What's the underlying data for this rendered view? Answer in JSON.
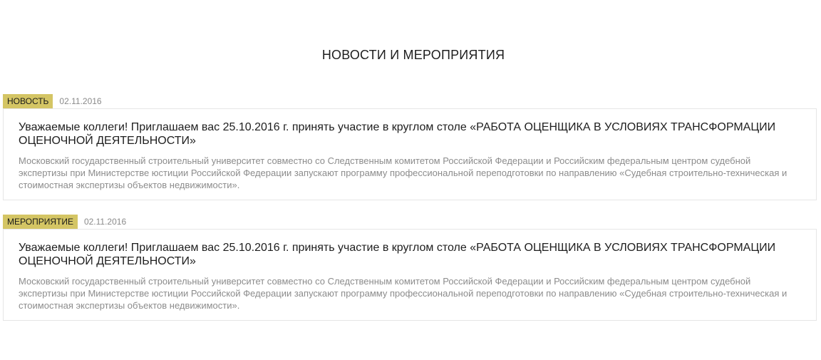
{
  "section": {
    "title": "НОВОСТИ И МЕРОПРИЯТИЯ"
  },
  "items": [
    {
      "tag": "НОВОСТЬ",
      "date": "02.11.2016",
      "title": "Уважаемые коллеги! Приглашаем вас 25.10.2016 г. принять участие в круглом столе «РАБОТА ОЦЕНЩИКА В УСЛОВИЯХ ТРАНСФОРМАЦИИ ОЦЕНОЧНОЙ ДЕЯТЕЛЬНОСТИ»",
      "text": "Московский государственный строительный университет совместно со Следственным комитетом Российской Федерации и Российским федеральным центром судебной экспертизы при Министерстве юстиции Российской Федерации запускают программу профессиональной переподготовки по направлению «Судебная строительно-техническая и стоимостная экспертизы объектов недвижимости»."
    },
    {
      "tag": "МЕРОПРИЯТИЕ",
      "date": "02.11.2016",
      "title": "Уважаемые коллеги! Приглашаем вас 25.10.2016 г. принять участие в круглом столе «РАБОТА ОЦЕНЩИКА В УСЛОВИЯХ ТРАНСФОРМАЦИИ ОЦЕНОЧНОЙ ДЕЯТЕЛЬНОСТИ»",
      "text": "Московский государственный строительный университет совместно со Следственным комитетом Российской Федерации и Российским федеральным центром судебной экспертизы при Министерстве юстиции Российской Федерации запускают программу профессиональной переподготовки по направлению «Судебная строительно-техническая и стоимостная экспертизы объектов недвижимости»."
    }
  ],
  "colors": {
    "tag_background": "#d4c564",
    "card_border": "#e6e6e6",
    "muted_text": "#8c8c8c"
  }
}
